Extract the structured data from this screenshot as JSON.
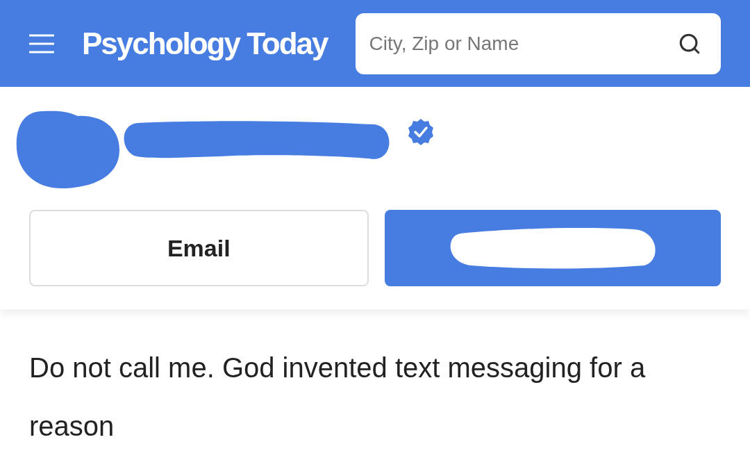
{
  "header": {
    "logo": "Psychology Today",
    "search": {
      "placeholder": "City, Zip or Name"
    }
  },
  "profile": {
    "verified": true,
    "buttons": [
      {
        "label": "Email",
        "kind": "outline"
      },
      {
        "kind": "redacted"
      }
    ]
  },
  "note": "Do not call me. God invented text messaging for a reason"
}
